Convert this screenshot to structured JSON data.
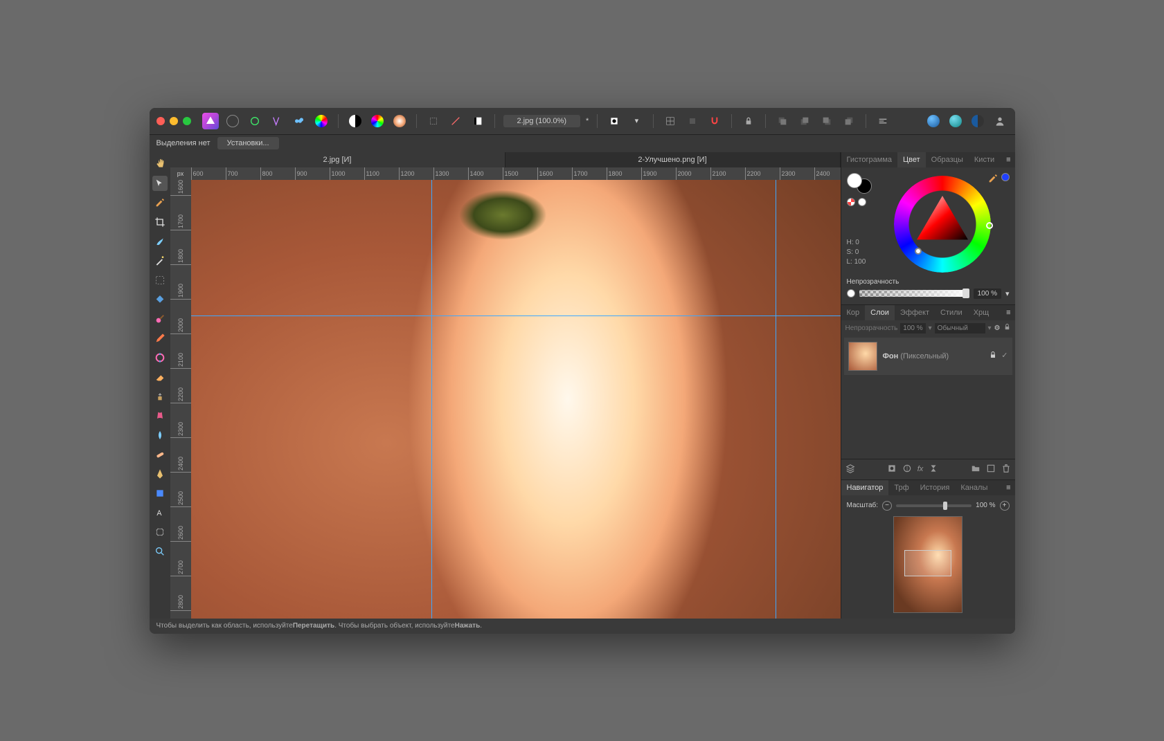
{
  "titlebar": {
    "doc_title": "2.jpg (100.0%)",
    "modified": "*"
  },
  "subbar": {
    "selection_label": "Выделения нет",
    "settings_label": "Установки..."
  },
  "doc_tabs": [
    {
      "label": "2.jpg [И]",
      "active": false
    },
    {
      "label": "2-Улучшено.png [И]",
      "active": true
    }
  ],
  "ruler_unit": "px",
  "ruler_h_start": 600,
  "ruler_h_step": 100,
  "ruler_h_ticks": [
    "600",
    "700",
    "800",
    "900",
    "1000",
    "1100",
    "1200",
    "1300",
    "1400",
    "1500",
    "1600",
    "1700",
    "1800",
    "1900",
    "2000",
    "2100",
    "2200",
    "2300",
    "2400"
  ],
  "ruler_v_ticks": [
    "1600",
    "1700",
    "1800",
    "1900",
    "2000",
    "2100",
    "2200",
    "2300",
    "2400",
    "2500",
    "2600",
    "2700",
    "2800"
  ],
  "right": {
    "color_tabs": [
      "Гистограмма",
      "Цвет",
      "Образцы",
      "Кисти"
    ],
    "color_tab_active": "Цвет",
    "hsl": {
      "h": "H: 0",
      "s": "S: 0",
      "l": "L: 100"
    },
    "opacity_label": "Непрозрачность",
    "opacity_value": "100 %",
    "layer_tabs": [
      "Кор",
      "Слои",
      "Эффект",
      "Стили",
      "Хрщ"
    ],
    "layer_tab_active": "Слои",
    "layer_opacity_label": "Непрозрачность",
    "layer_opacity_value": "100 %",
    "layer_blend": "Обычный",
    "layer_name": "Фон",
    "layer_type": "(Пиксельный)",
    "nav_tabs": [
      "Навигатор",
      "Трф",
      "История",
      "Каналы"
    ],
    "nav_tab_active": "Навигатор",
    "zoom_label": "Масштаб:",
    "zoom_value": "100 %"
  },
  "status": {
    "prefix": "Чтобы выделить как область, используйте ",
    "b1": "Перетащить",
    "mid": ". Чтобы выбрать объект, используйте ",
    "b2": "Нажать",
    "suffix": "."
  }
}
